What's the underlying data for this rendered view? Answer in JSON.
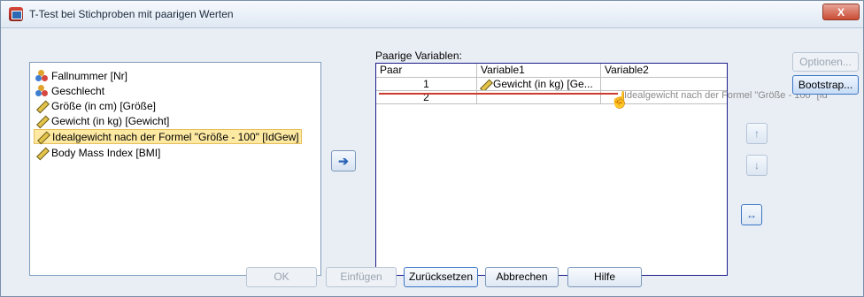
{
  "window": {
    "title": "T-Test bei Stichproben mit paarigen Werten",
    "close_label": "X"
  },
  "source_list": {
    "items": [
      {
        "label": "Fallnummer [Nr]",
        "type": "nominal"
      },
      {
        "label": "Geschlecht",
        "type": "nominal"
      },
      {
        "label": "Größe (in cm) [Größe]",
        "type": "scale"
      },
      {
        "label": "Gewicht (in kg) [Gewicht]",
        "type": "scale"
      },
      {
        "label": "Idealgewicht nach der Formel \"Größe - 100\" [IdGew]",
        "type": "scale",
        "selected": true
      },
      {
        "label": "Body Mass Index [BMI]",
        "type": "scale"
      }
    ]
  },
  "move_button": "➔",
  "pairs": {
    "label": "Paarige Variablen:",
    "columns": [
      "Paar",
      "Variable1",
      "Variable2"
    ],
    "rows": [
      {
        "pair": "1",
        "var1": "Gewicht (in kg) [Ge...",
        "var2": ""
      },
      {
        "pair": "2",
        "var1": "",
        "var2": ""
      }
    ],
    "drag_ghost": "Idealgewicht nach der Formel \"Größe - 100\" [Id"
  },
  "side_buttons": {
    "options": "Optionen...",
    "bootstrap": "Bootstrap..."
  },
  "order_buttons": {
    "up": "↑",
    "down": "↓",
    "swap": "↔"
  },
  "bottom_buttons": {
    "ok": "OK",
    "paste": "Einfügen",
    "reset": "Zurücksetzen",
    "cancel": "Abbrechen",
    "help": "Hilfe"
  }
}
